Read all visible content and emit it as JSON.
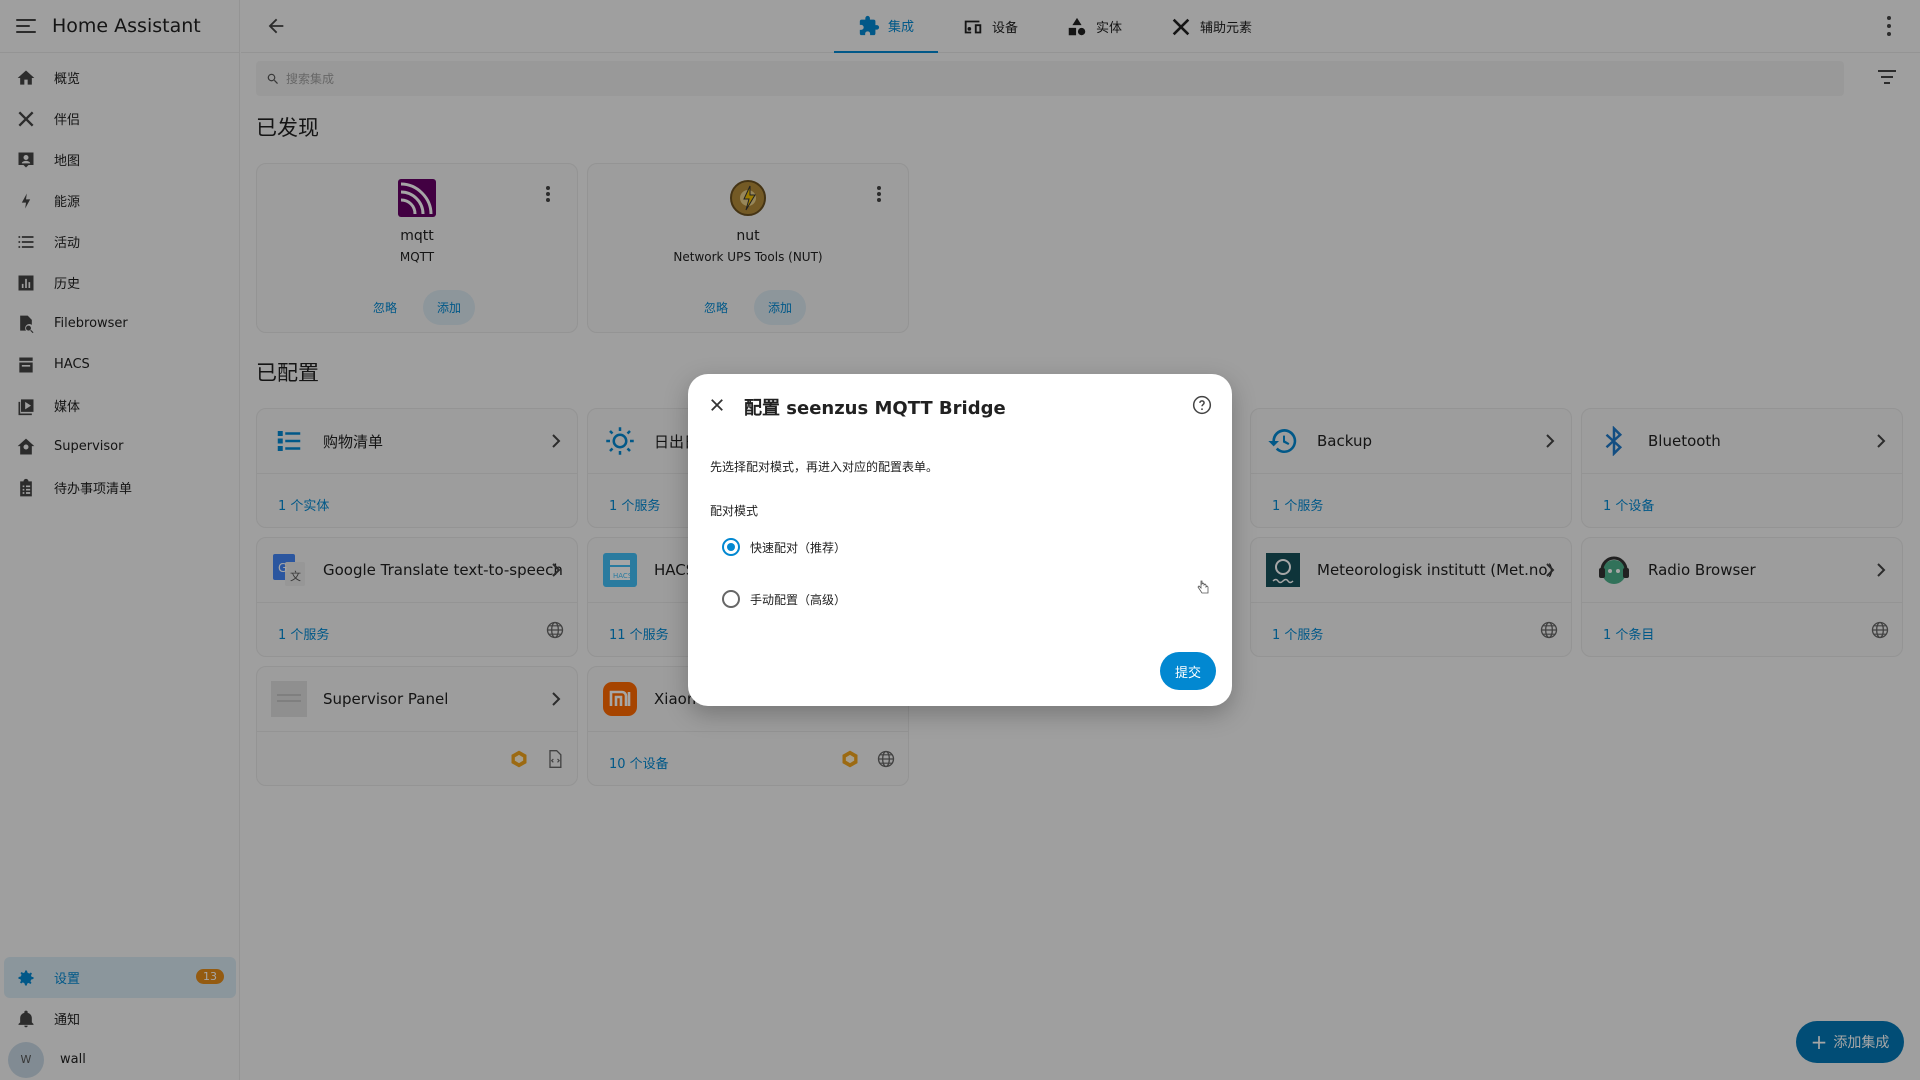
{
  "app": {
    "title": "Home Assistant"
  },
  "sidebar": {
    "items": [
      {
        "label": "概览",
        "icon": "home-icon"
      },
      {
        "label": "伴侣",
        "icon": "tools-icon"
      },
      {
        "label": "地图",
        "icon": "map-account-icon"
      },
      {
        "label": "能源",
        "icon": "lightning-icon"
      },
      {
        "label": "活动",
        "icon": "list-icon"
      },
      {
        "label": "历史",
        "icon": "chart-bar-icon"
      },
      {
        "label": "Filebrowser",
        "icon": "file-search-icon"
      },
      {
        "label": "HACS",
        "icon": "hacs-icon"
      },
      {
        "label": "媒体",
        "icon": "media-icon"
      },
      {
        "label": "Supervisor",
        "icon": "supervisor-icon"
      },
      {
        "label": "待办事项清单",
        "icon": "clipboard-list-icon"
      }
    ],
    "settings": {
      "label": "设置",
      "badge": "13"
    },
    "notifications": {
      "label": "通知"
    },
    "user": {
      "initial": "W",
      "name": "wall"
    }
  },
  "tabs": [
    {
      "label": "集成",
      "icon": "puzzle-icon",
      "active": true
    },
    {
      "label": "设备",
      "icon": "devices-icon",
      "active": false
    },
    {
      "label": "实体",
      "icon": "shapes-icon",
      "active": false
    },
    {
      "label": "辅助元素",
      "icon": "tools-icon",
      "active": false
    }
  ],
  "search": {
    "placeholder": "搜索集成"
  },
  "discovered": {
    "heading": "已发现",
    "cards": [
      {
        "name": "mqtt",
        "subtitle": "MQTT",
        "ignore": "忽略",
        "add": "添加"
      },
      {
        "name": "nut",
        "subtitle": "Network UPS Tools (NUT)",
        "ignore": "忽略",
        "add": "添加"
      }
    ]
  },
  "configured": {
    "heading": "已配置",
    "cards": [
      {
        "name": "购物清单",
        "footer": "1 个实体"
      },
      {
        "name": "日出日落",
        "footer": "1 个服务"
      },
      {
        "name": "Backup",
        "footer": "1 个服务"
      },
      {
        "name": "Bluetooth",
        "footer": "1 个设备"
      },
      {
        "name": "Google Translate text-to-speech",
        "footer": "1 个服务"
      },
      {
        "name": "HACS",
        "footer": "11 个服务"
      },
      {
        "name": "Meteorologisk institutt (Met.no)",
        "footer": "1 个服务"
      },
      {
        "name": "Radio Browser",
        "footer": "1 个条目"
      },
      {
        "name": "Supervisor Panel",
        "footer": ""
      },
      {
        "name": "Xiaomi",
        "footer": "10 个设备"
      }
    ]
  },
  "dialog": {
    "title": "配置 seenzus MQTT Bridge",
    "description": "先选择配对模式，再进入对应的配置表单。",
    "mode_label": "配对模式",
    "options": [
      {
        "label": "快速配对（推荐）",
        "checked": true
      },
      {
        "label": "手动配置（高级）",
        "checked": false
      }
    ],
    "submit": "提交"
  },
  "fab": {
    "label": "添加集成"
  },
  "colors": {
    "primary": "#0288d1",
    "badge": "#e38c1b"
  }
}
